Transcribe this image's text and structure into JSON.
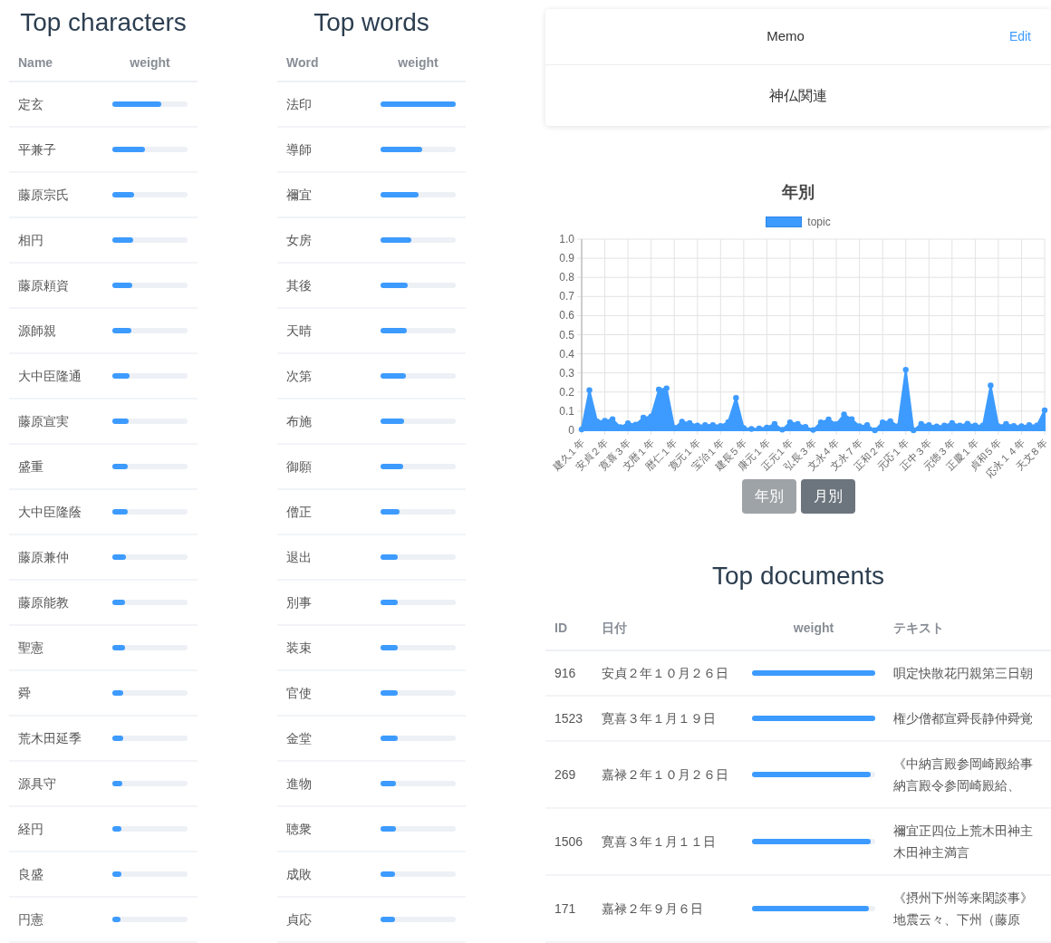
{
  "characters": {
    "title": "Top characters",
    "columns": [
      "Name",
      "weight"
    ],
    "rows": [
      {
        "name": "定玄",
        "level": 0.65
      },
      {
        "name": "平兼子",
        "level": 0.43
      },
      {
        "name": "藤原宗氏",
        "level": 0.29
      },
      {
        "name": "相円",
        "level": 0.28
      },
      {
        "name": "藤原頼資",
        "level": 0.26
      },
      {
        "name": "源師親",
        "level": 0.25
      },
      {
        "name": "大中臣隆通",
        "level": 0.23
      },
      {
        "name": "藤原宣実",
        "level": 0.22
      },
      {
        "name": "盛重",
        "level": 0.2
      },
      {
        "name": "大中臣隆蔭",
        "level": 0.2
      },
      {
        "name": "藤原兼仲",
        "level": 0.18
      },
      {
        "name": "藤原能教",
        "level": 0.17
      },
      {
        "name": "聖憲",
        "level": 0.17
      },
      {
        "name": "舜",
        "level": 0.15
      },
      {
        "name": "荒木田延季",
        "level": 0.15
      },
      {
        "name": "源具守",
        "level": 0.13
      },
      {
        "name": "経円",
        "level": 0.12
      },
      {
        "name": "良盛",
        "level": 0.12
      },
      {
        "name": "円憲",
        "level": 0.11
      }
    ]
  },
  "words": {
    "title": "Top words",
    "columns": [
      "Word",
      "weight"
    ],
    "rows": [
      {
        "name": "法印",
        "level": 1
      },
      {
        "name": "導師",
        "level": 0.55
      },
      {
        "name": "禰宜",
        "level": 0.5
      },
      {
        "name": "女房",
        "level": 0.41
      },
      {
        "name": "其後",
        "level": 0.36
      },
      {
        "name": "天晴",
        "level": 0.35
      },
      {
        "name": "次第",
        "level": 0.34
      },
      {
        "name": "布施",
        "level": 0.31
      },
      {
        "name": "御願",
        "level": 0.3
      },
      {
        "name": "僧正",
        "level": 0.25
      },
      {
        "name": "退出",
        "level": 0.23
      },
      {
        "name": "別事",
        "level": 0.23
      },
      {
        "name": "装束",
        "level": 0.23
      },
      {
        "name": "官使",
        "level": 0.23
      },
      {
        "name": "金堂",
        "level": 0.23
      },
      {
        "name": "進物",
        "level": 0.21
      },
      {
        "name": "聴衆",
        "level": 0.2
      },
      {
        "name": "成敗",
        "level": 0.19
      },
      {
        "name": "貞応",
        "level": 0.19
      }
    ]
  },
  "memo": {
    "title": "Memo",
    "edit": "Edit",
    "body": "神仏関連"
  },
  "chart": {
    "title": "年別",
    "chart_data": {
      "type": "area",
      "categories": [
        "建久１年",
        null,
        null,
        "安貞２年",
        null,
        null,
        "寛喜３年",
        null,
        null,
        "文暦１年",
        null,
        null,
        "暦仁１年",
        null,
        null,
        "寛元１年",
        null,
        null,
        "宝治１年",
        null,
        null,
        "建長５年",
        null,
        null,
        "康元１年",
        null,
        null,
        "正元１年",
        null,
        null,
        "弘長３年",
        null,
        null,
        "文永４年",
        null,
        null,
        "文永７年",
        null,
        null,
        "正和２年",
        null,
        null,
        "元応１年",
        null,
        null,
        "正中３年",
        null,
        null,
        "元徳３年",
        null,
        null,
        "正慶１年",
        null,
        null,
        "貞和５年",
        null,
        null,
        "応永１４年",
        null,
        null,
        "天文８年"
      ],
      "series": [
        {
          "name": "topic",
          "color": "#3d9bff",
          "values": [
            0.005,
            0.21,
            0.047,
            0.05,
            0.058,
            0.017,
            0.037,
            0.03,
            0.066,
            0.072,
            0.213,
            0.22,
            0.013,
            0.045,
            0.038,
            0.025,
            0.027,
            0.028,
            0.023,
            0.043,
            0.17,
            0.012,
            0.007,
            0.01,
            0.015,
            0.033,
            0.003,
            0.042,
            0.033,
            0.018,
            0.002,
            0.042,
            0.057,
            0.032,
            0.083,
            0.058,
            0.022,
            0.027,
            0,
            0.042,
            0.048,
            0.022,
            0.317,
            0,
            0.033,
            0.027,
            0.02,
            0.025,
            0.038,
            0.025,
            0.035,
            0.025,
            0.025,
            0.235,
            0.022,
            0.033,
            0.023,
            0.022,
            0.027,
            0.025,
            0.105
          ]
        }
      ],
      "ylim": [
        0,
        1
      ],
      "grid": true,
      "yticks": [
        {
          "value": 0,
          "label": "0"
        },
        {
          "value": 0.1,
          "label": "0.1"
        },
        {
          "value": 0.2,
          "label": "0.2"
        },
        {
          "value": 0.3,
          "label": "0.3"
        },
        {
          "value": 0.4,
          "label": "0.4"
        },
        {
          "value": 0.5,
          "label": "0.5"
        },
        {
          "value": 0.6,
          "label": "0.6"
        },
        {
          "value": 0.7,
          "label": "0.7"
        },
        {
          "value": 0.8,
          "label": "0.8"
        },
        {
          "value": 0.9,
          "label": "0.9"
        },
        {
          "value": 1,
          "label": "1.0"
        }
      ]
    },
    "buttons": [
      {
        "label": "年別",
        "selected": true
      },
      {
        "label": "月別",
        "selected": false
      }
    ]
  },
  "documents": {
    "title": "Top documents",
    "columns": [
      "ID",
      "日付",
      "weight",
      "テキスト"
    ],
    "rows": [
      {
        "id": "916",
        "date": "安貞２年１０月２６日",
        "level": 1,
        "text": [
          "唄定快散花円親第三日朝"
        ]
      },
      {
        "id": "1523",
        "date": "寛喜３年１月１９日",
        "level": 1,
        "text": [
          "権少僧都宣舜長静仲舜覚"
        ]
      },
      {
        "id": "269",
        "date": "嘉禄２年１０月２６日",
        "level": 0.96,
        "text": [
          "《中納言殿参岡崎殿給事",
          "納言殿令参岡崎殿給、"
        ]
      },
      {
        "id": "1506",
        "date": "寛喜３年１月１１日",
        "level": 0.96,
        "text": [
          "禰宜正四位上荒木田神主",
          "木田神主満言"
        ]
      },
      {
        "id": "171",
        "date": "嘉禄２年９月６日",
        "level": 0.95,
        "text": [
          "《摂州下州等来閑談事》",
          "地震云々、下州（藤原"
        ]
      }
    ]
  }
}
